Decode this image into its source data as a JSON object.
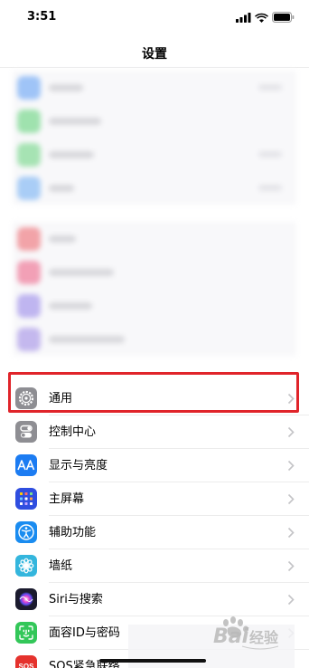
{
  "status_bar": {
    "time": "3:51"
  },
  "nav": {
    "title": "设置"
  },
  "settings_items": [
    {
      "label": "通用",
      "icon": "gear-icon",
      "color": "#8e8e93"
    },
    {
      "label": "控制中心",
      "icon": "toggle-icon",
      "color": "#8e8e93"
    },
    {
      "label": "显示与亮度",
      "icon": "text-size-icon",
      "color": "#1c7cf2"
    },
    {
      "label": "主屏幕",
      "icon": "grid-icon",
      "color": "#2f4ee0"
    },
    {
      "label": "辅助功能",
      "icon": "accessibility-icon",
      "color": "#1a8cf0"
    },
    {
      "label": "墙纸",
      "icon": "flower-icon",
      "color": "#34b6dd"
    },
    {
      "label": "Siri与搜索",
      "icon": "siri-icon",
      "color": "#1b1b2e"
    },
    {
      "label": "面容ID与密码",
      "icon": "face-id-icon",
      "color": "#33c759"
    },
    {
      "label": "SOS紧急联络",
      "icon": "sos-icon",
      "color": "#e5322d"
    }
  ],
  "colors": {
    "highlight": "#e0242a",
    "separator": "#ececec",
    "chevron": "#c4c4c7"
  }
}
